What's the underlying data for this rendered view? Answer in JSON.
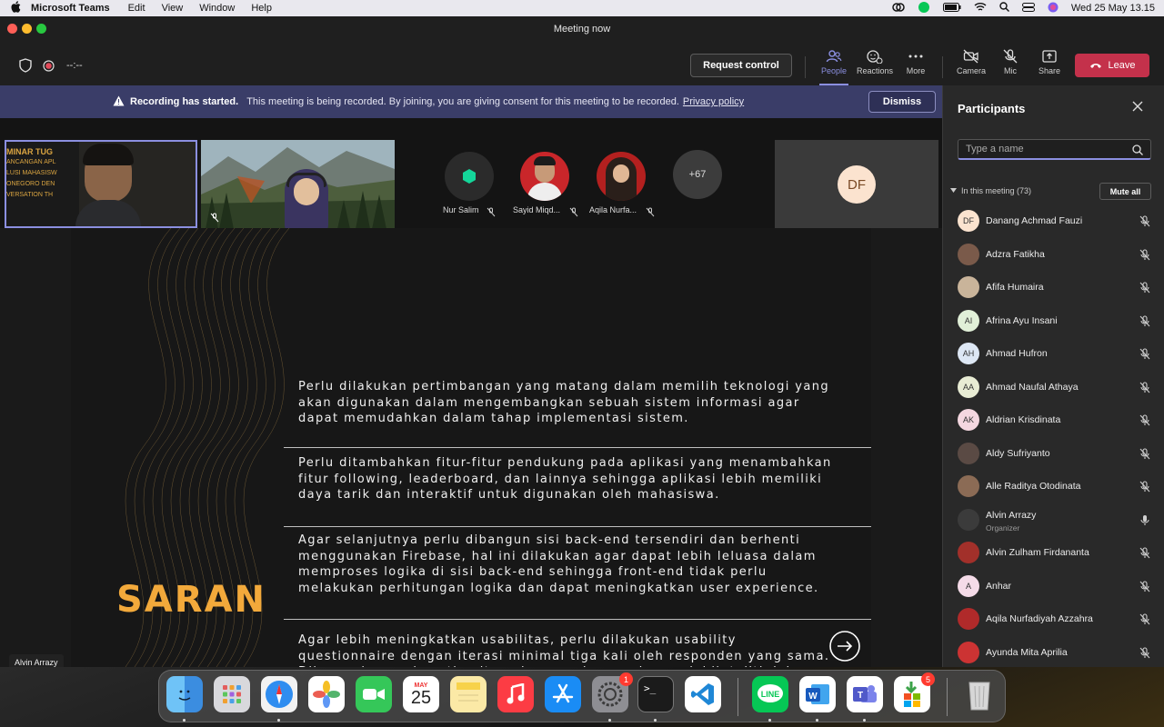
{
  "menubar": {
    "app_name": "Microsoft Teams",
    "items": [
      "Edit",
      "View",
      "Window",
      "Help"
    ],
    "datetime": "Wed 25 May  13.15"
  },
  "window": {
    "title": "Meeting now",
    "timer": "--:--"
  },
  "toolbar": {
    "request_control": "Request control",
    "people": "People",
    "reactions": "Reactions",
    "more": "More",
    "camera": "Camera",
    "mic": "Mic",
    "share": "Share",
    "leave": "Leave"
  },
  "banner": {
    "bold": "Recording has started.",
    "text": "This meeting is being recorded. By joining, you are giving consent for this meeting to be recorded.",
    "link": "Privacy policy",
    "dismiss": "Dismiss"
  },
  "video_strip": {
    "presenter_slide_text": [
      "MINAR TUG",
      "ANCANGAN APL",
      "LUSI MAHASISW",
      "ONEGORO DEN",
      "VERSATION TH"
    ],
    "participants": [
      {
        "name": "Nur Salim"
      },
      {
        "name": "Sayid Miqd..."
      },
      {
        "name": "Aqila Nurfa..."
      }
    ],
    "overflow": "+67",
    "tile_initials": "DF"
  },
  "slide": {
    "title": "SARAN",
    "paragraphs": [
      "Perlu dilakukan pertimbangan yang matang dalam memilih teknologi yang akan digunakan dalam mengembangkan sebuah sistem informasi agar dapat memudahkan dalam tahap implementasi sistem.",
      "Perlu ditambahkan fitur-fitur pendukung pada aplikasi yang menambahkan fitur following, leaderboard, dan lainnya sehingga aplikasi lebih memiliki daya tarik dan interaktif untuk digunakan oleh mahasiswa.",
      "Agar selanjutnya perlu dibangun sisi back-end tersendiri dan berhenti menggunakan Firebase, hal ini dilakukan agar dapat lebih leluasa dalam memproses logika di sisi back-end sehingga front-end tidak perlu melakukan perhitungan logika dan dapat meningkatkan user experience.",
      "Agar lebih meningkatkan usabilitas, perlu dilakukan usability questionnaire dengan iterasi minimal tiga kali oleh responden yang sama. Dikarenakan pada setiap iterasi responden cenderung lebih teliti dalam menemukan kekurangan aplikasi dari aspek lain, sehingga feedback dari kuesioner dapat menjadi bahan evaluasi yang lebih baik dalam menutupi kekurangan aplikasi"
    ],
    "presenter_name": "Alvin Arrazy"
  },
  "panel": {
    "title": "Participants",
    "search_placeholder": "Type a name",
    "section": "In this meeting (73)",
    "mute_all": "Mute all",
    "people": [
      {
        "name": "Danang Achmad Fauzi",
        "initials": "DF",
        "color": "#fbe3cf",
        "mic": "muted"
      },
      {
        "name": "Adzra Fatikha",
        "initials": "",
        "color": "#7a5a4a",
        "mic": "muted"
      },
      {
        "name": "Afifa Humaira",
        "initials": "",
        "color": "#c9b49a",
        "mic": "muted"
      },
      {
        "name": "Afrina Ayu Insani",
        "initials": "AI",
        "color": "#e1f0d8",
        "mic": "muted"
      },
      {
        "name": "Ahmad Hufron",
        "initials": "AH",
        "color": "#dde7f4",
        "mic": "muted"
      },
      {
        "name": "Ahmad Naufal Athaya",
        "initials": "AA",
        "color": "#e8ecd4",
        "mic": "muted"
      },
      {
        "name": "Aldrian Krisdinata",
        "initials": "AK",
        "color": "#f4d7e0",
        "mic": "muted"
      },
      {
        "name": "Aldy Sufriyanto",
        "initials": "",
        "color": "#5a4a44",
        "mic": "muted"
      },
      {
        "name": "Alle Raditya Otodinata",
        "initials": "",
        "color": "#8b6b55",
        "mic": "muted"
      },
      {
        "name": "Alvin Arrazy",
        "initials": "",
        "color": "#3b3b3b",
        "mic": "on",
        "role": "Organizer"
      },
      {
        "name": "Alvin Zulham Firdananta",
        "initials": "",
        "color": "#a2302a",
        "mic": "muted"
      },
      {
        "name": "Anhar",
        "initials": "A",
        "color": "#f5dbe8",
        "mic": "muted"
      },
      {
        "name": "Aqila Nurfadiyah Azzahra",
        "initials": "",
        "color": "#b02a2a",
        "mic": "muted"
      },
      {
        "name": "Ayunda Mita Aprilia",
        "initials": "",
        "color": "#cc3333",
        "mic": "muted"
      }
    ]
  },
  "dock": {
    "calendar_month": "MAY",
    "calendar_day": "25",
    "badges": {
      "settings": "1",
      "store": "5"
    }
  }
}
